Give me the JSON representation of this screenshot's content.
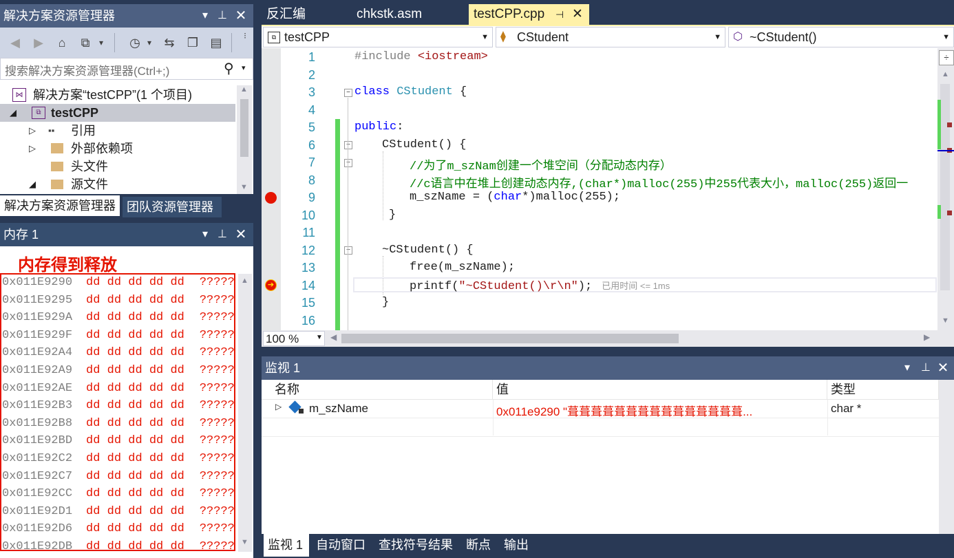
{
  "solution_explorer": {
    "title": "解决方案资源管理器",
    "search_placeholder": "搜索解决方案资源管理器(Ctrl+;)",
    "tree": [
      {
        "label": "解决方案“testCPP”(1 个项目)",
        "icon": "solution-icon"
      },
      {
        "label": "testCPP",
        "icon": "cpp-project-icon"
      },
      {
        "label": "引用",
        "icon": "references-icon"
      },
      {
        "label": "外部依赖项",
        "icon": "external-deps-icon"
      },
      {
        "label": "头文件",
        "icon": "folder-icon"
      },
      {
        "label": "源文件",
        "icon": "folder-icon"
      }
    ],
    "tabs": [
      "解决方案资源管理器",
      "团队资源管理器"
    ]
  },
  "memory": {
    "title": "内存 1",
    "annotation": "内存得到释放",
    "annotation_color": "#e51400",
    "rows": [
      {
        "addr": "0x011E9290",
        "hex": "dd dd dd dd dd",
        "ascii": "?????"
      },
      {
        "addr": "0x011E9295",
        "hex": "dd dd dd dd dd",
        "ascii": "?????"
      },
      {
        "addr": "0x011E929A",
        "hex": "dd dd dd dd dd",
        "ascii": "?????"
      },
      {
        "addr": "0x011E929F",
        "hex": "dd dd dd dd dd",
        "ascii": "?????"
      },
      {
        "addr": "0x011E92A4",
        "hex": "dd dd dd dd dd",
        "ascii": "?????"
      },
      {
        "addr": "0x011E92A9",
        "hex": "dd dd dd dd dd",
        "ascii": "?????"
      },
      {
        "addr": "0x011E92AE",
        "hex": "dd dd dd dd dd",
        "ascii": "?????"
      },
      {
        "addr": "0x011E92B3",
        "hex": "dd dd dd dd dd",
        "ascii": "?????"
      },
      {
        "addr": "0x011E92B8",
        "hex": "dd dd dd dd dd",
        "ascii": "?????"
      },
      {
        "addr": "0x011E92BD",
        "hex": "dd dd dd dd dd",
        "ascii": "?????"
      },
      {
        "addr": "0x011E92C2",
        "hex": "dd dd dd dd dd",
        "ascii": "?????"
      },
      {
        "addr": "0x011E92C7",
        "hex": "dd dd dd dd dd",
        "ascii": "?????"
      },
      {
        "addr": "0x011E92CC",
        "hex": "dd dd dd dd dd",
        "ascii": "?????"
      },
      {
        "addr": "0x011E92D1",
        "hex": "dd dd dd dd dd",
        "ascii": "?????"
      },
      {
        "addr": "0x011E92D6",
        "hex": "dd dd dd dd dd",
        "ascii": "?????"
      },
      {
        "addr": "0x011E92DB",
        "hex": "dd dd dd dd dd",
        "ascii": "?????"
      }
    ]
  },
  "editor": {
    "tabs": [
      "反汇编",
      "chkstk.asm",
      "testCPP.cpp"
    ],
    "active_tab": "testCPP.cpp",
    "nav": {
      "project": "testCPP",
      "class": "CStudent",
      "member": "~CStudent()"
    },
    "zoom": "100 %",
    "elapsed_hint": "已用时间 <= 1ms",
    "lines": [
      {
        "n": "1"
      },
      {
        "n": "2"
      },
      {
        "n": "3"
      },
      {
        "n": "4"
      },
      {
        "n": "5"
      },
      {
        "n": "6"
      },
      {
        "n": "7"
      },
      {
        "n": "8"
      },
      {
        "n": "9"
      },
      {
        "n": "10"
      },
      {
        "n": "11"
      },
      {
        "n": "12"
      },
      {
        "n": "13"
      },
      {
        "n": "14"
      },
      {
        "n": "15"
      },
      {
        "n": "16"
      }
    ],
    "code": {
      "l1_pp": "#include ",
      "l1_hdr": "<iostream>",
      "l3_kw": "class",
      "l3_name": " CStudent",
      "l3_rest": " {",
      "l5_kw": "public",
      "l5_rest": ":",
      "l6": "CStudent() {",
      "l7": "//为了m_szNam创建一个堆空间（分配动态内存）",
      "l8": "//c语言中在堆上创建动态内存,(char*)malloc(255)中255代表大小，malloc(255)返回一",
      "l9_a": "m_szName = (",
      "l9_kw": "char",
      "l9_b": "*)malloc(255);",
      "l10": "}",
      "l12": "~CStudent() {",
      "l13": "free(m_szName);",
      "l14_a": "printf(",
      "l14_str": "\"~CStudent()\\r\\n\"",
      "l14_b": ");",
      "l15": "}"
    }
  },
  "watch": {
    "title": "监视 1",
    "columns": [
      "名称",
      "值",
      "类型"
    ],
    "rows": [
      {
        "name": "m_szName",
        "value": "0x011e9290 \"葺葺葺葺葺葺葺葺葺葺葺葺葺葺葺...",
        "type": "char *"
      }
    ],
    "tabs": [
      "监视 1",
      "自动窗口",
      "查找符号结果",
      "断点",
      "输出"
    ]
  },
  "colors": {
    "frame": "#293955",
    "title_active": "#4d6082",
    "active_tab": "#fff1a8",
    "breakpoint": "#e51400",
    "change_bar": "#5cd65c"
  }
}
